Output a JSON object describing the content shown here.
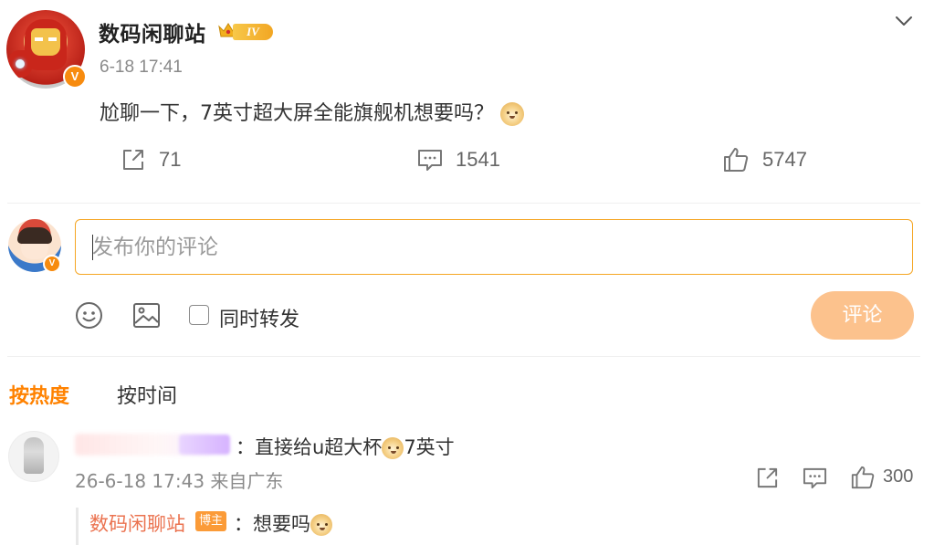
{
  "post": {
    "author": "数码闲聊站",
    "level_badge": "IV",
    "verified_mark": "V",
    "timestamp": "6-18 17:41",
    "content": "尬聊一下，7英寸超大屏全能旗舰机想要吗？",
    "content_emoji": "doge-emoji",
    "stats": {
      "reposts": "71",
      "comments": "1541",
      "likes": "5747"
    },
    "icons": {
      "menu": "chevron-down-icon",
      "repost": "share-icon",
      "comment": "comment-icon",
      "like": "thumbs-up-icon"
    }
  },
  "composer": {
    "placeholder": "发布你的评论",
    "value": "",
    "verified_mark": "V",
    "repost_label": "同时转发",
    "repost_checked": false,
    "submit_label": "评论",
    "icons": {
      "emoji": "smiley-icon",
      "image": "image-icon"
    }
  },
  "sort": {
    "hot_label": "按热度",
    "time_label": "按时间",
    "active": "hot"
  },
  "comments": [
    {
      "author_obscured": true,
      "text": "：直接给u超大杯",
      "text_tail": "7英寸",
      "meta": "26-6-18 17:43 来自广东",
      "likes": "300",
      "replies": [
        {
          "author": "数码闲聊站",
          "badge": "博主",
          "text": "：想要吗"
        }
      ]
    }
  ],
  "colors": {
    "accent_orange": "#ff8200",
    "input_border": "#f5a623",
    "submit_bg": "#fcc28d",
    "reply_author": "#eb7350",
    "blogger_badge": "#fb9b38",
    "verified": "#f78b0f"
  }
}
